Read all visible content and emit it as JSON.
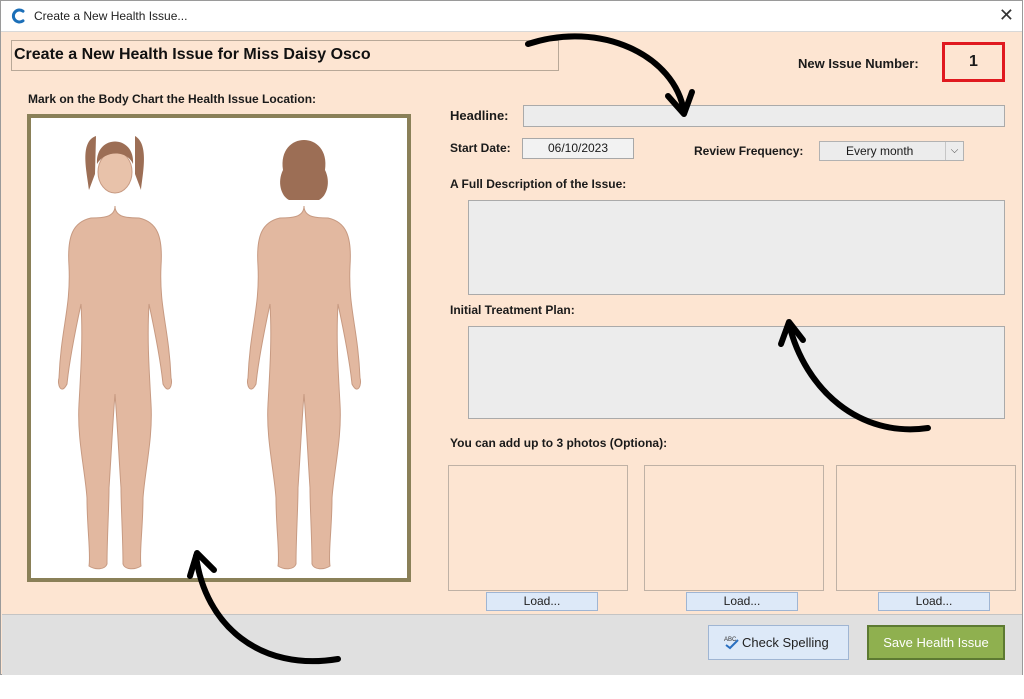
{
  "window": {
    "title": "Create a New Health Issue..."
  },
  "header": {
    "heading": "Create a New Health Issue for Miss Daisy Osco",
    "issue_number_label": "New Issue Number:",
    "issue_number": "1"
  },
  "body_chart": {
    "label": "Mark on the Body Chart the Health Issue Location:"
  },
  "form": {
    "headline_label": "Headline:",
    "headline_value": "",
    "start_date_label": "Start Date:",
    "start_date_value": "06/10/2023",
    "review_frequency_label": "Review Frequency:",
    "review_frequency_value": "Every month",
    "description_label": "A Full Description of the Issue:",
    "description_value": "",
    "treatment_label": "Initial Treatment Plan:",
    "treatment_value": ""
  },
  "photos": {
    "label": "You can add up to 3 photos (Optiona):",
    "load_labels": [
      "Load...",
      "Load...",
      "Load..."
    ]
  },
  "footer": {
    "spell_check_label": "Check Spelling",
    "save_label": "Save Health Issue"
  },
  "colors": {
    "window_bg": "#fde5d2",
    "highlight_border": "#e0191f",
    "save_button": "#8fb04f",
    "chart_border": "#8a8058"
  },
  "icons": [
    "app-logo-icon",
    "close-icon",
    "dropdown-chevron-icon",
    "spell-check-icon"
  ]
}
